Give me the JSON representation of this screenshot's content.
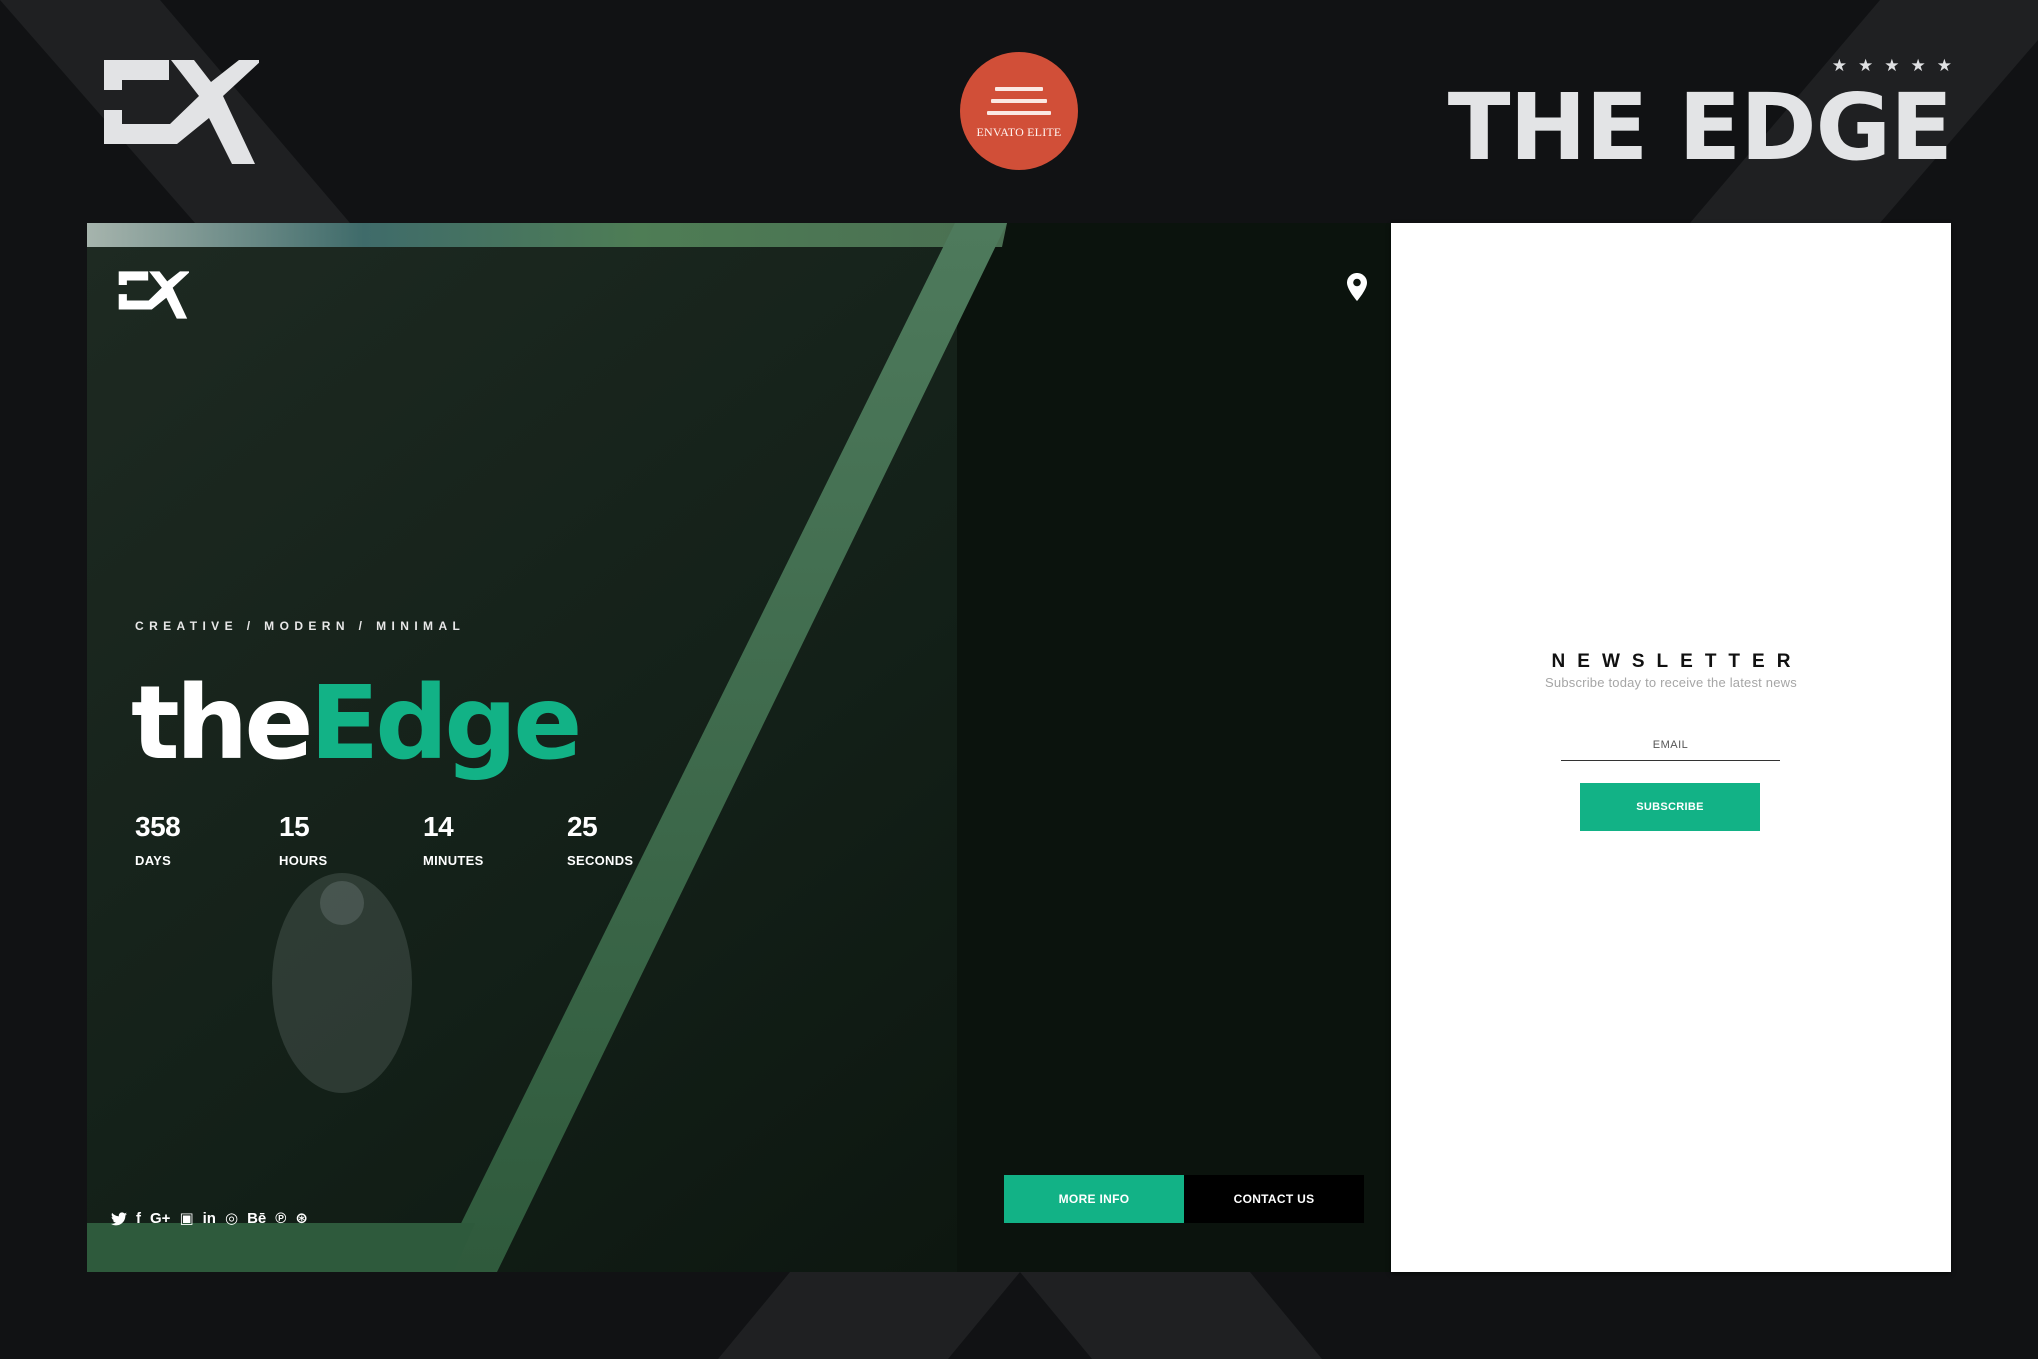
{
  "header": {
    "logo": "EX",
    "badge": {
      "label": "ENVATO ELITE",
      "color": "#d14f38"
    },
    "rating_stars": 5,
    "star_glyph": "★",
    "title": "THE EDGE"
  },
  "hero": {
    "logo": "EX",
    "location_icon": "map-pin-icon",
    "tagline": "CREATIVE / MODERN / MINIMAL",
    "brand": {
      "part1": "the",
      "part2": "Edge"
    },
    "countdown": [
      {
        "value": "358",
        "label": "DAYS"
      },
      {
        "value": "15",
        "label": "HOURS"
      },
      {
        "value": "14",
        "label": "MINUTES"
      },
      {
        "value": "25",
        "label": "SECONDS"
      }
    ],
    "social": [
      {
        "name": "twitter",
        "glyph": "🐦"
      },
      {
        "name": "facebook",
        "glyph": "f"
      },
      {
        "name": "google-plus",
        "glyph": "G+"
      },
      {
        "name": "youtube",
        "glyph": "▣"
      },
      {
        "name": "linkedin",
        "glyph": "in"
      },
      {
        "name": "instagram",
        "glyph": "◎"
      },
      {
        "name": "behance",
        "glyph": "Bē"
      },
      {
        "name": "pinterest",
        "glyph": "℗"
      },
      {
        "name": "dribbble",
        "glyph": "⊛"
      }
    ],
    "buttons": {
      "more_info": "MORE INFO",
      "contact_us": "CONTACT US"
    }
  },
  "newsletter": {
    "title": "NEWSLETTER",
    "subtitle": "Subscribe today to receive the latest news",
    "email_placeholder": "EMAIL",
    "email_value": "",
    "subscribe_label": "SUBSCRIBE"
  },
  "colors": {
    "accent": "#12b286",
    "background": "#111214",
    "badge": "#d14f38"
  }
}
